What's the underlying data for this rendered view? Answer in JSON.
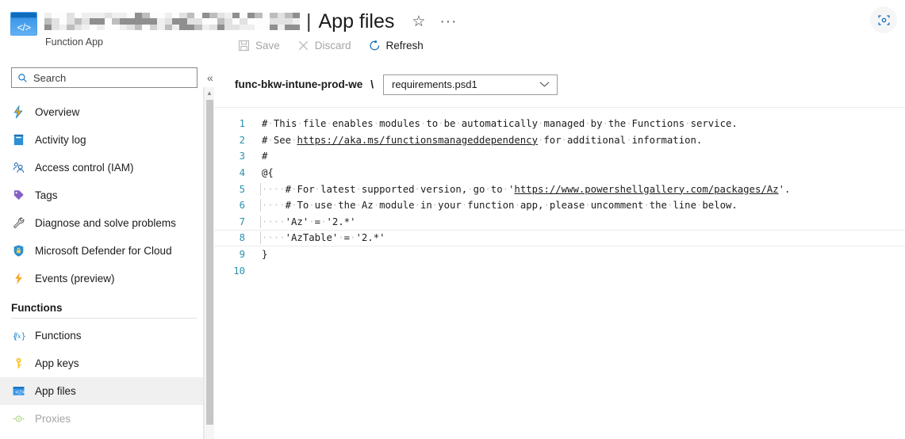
{
  "header": {
    "app_icon_glyph": "</>",
    "resource_name_redacted": true,
    "title_separator": "|",
    "page_title": "App files",
    "subtitle": "Function App",
    "star_icon": "star-outline-icon",
    "ellipsis": "···",
    "feedback_icon": "screenshot-capture-icon"
  },
  "toolbar": {
    "items": [
      {
        "label": "Save",
        "icon": "save-disk-icon",
        "enabled": false
      },
      {
        "label": "Discard",
        "icon": "close-x-icon",
        "enabled": false
      },
      {
        "label": "Refresh",
        "icon": "refresh-circular-arrow-icon",
        "enabled": true
      }
    ]
  },
  "sidebar": {
    "search": {
      "placeholder": "Search",
      "value": "",
      "icon": "search-icon"
    },
    "collapse_icon": "«",
    "items": [
      {
        "label": "Overview",
        "icon": "overview-lightning-icon",
        "selected": false,
        "disabled": false
      },
      {
        "label": "Activity log",
        "icon": "activity-log-book-icon",
        "selected": false,
        "disabled": false
      },
      {
        "label": "Access control (IAM)",
        "icon": "access-control-people-icon",
        "selected": false,
        "disabled": false
      },
      {
        "label": "Tags",
        "icon": "tag-icon",
        "selected": false,
        "disabled": false
      },
      {
        "label": "Diagnose and solve problems",
        "icon": "wrench-icon",
        "selected": false,
        "disabled": false
      },
      {
        "label": "Microsoft Defender for Cloud",
        "icon": "shield-lock-icon",
        "selected": false,
        "disabled": false
      },
      {
        "label": "Events (preview)",
        "icon": "events-lightning-icon",
        "selected": false,
        "disabled": false
      }
    ],
    "group": {
      "title": "Functions",
      "items": [
        {
          "label": "Functions",
          "icon": "function-fx-icon",
          "selected": false,
          "disabled": false
        },
        {
          "label": "App keys",
          "icon": "key-icon",
          "selected": false,
          "disabled": false
        },
        {
          "label": "App files",
          "icon": "app-files-code-window-icon",
          "selected": true,
          "disabled": false
        },
        {
          "label": "Proxies",
          "icon": "proxies-icon",
          "selected": false,
          "disabled": true
        }
      ]
    }
  },
  "content": {
    "breadcrumb_path": "func-bkw-intune-prod-we",
    "breadcrumb_separator": "\\",
    "file_select": {
      "value": "requirements.psd1",
      "chevron": "chevron-down-icon"
    }
  },
  "editor": {
    "line_numbers": [
      "1",
      "2",
      "3",
      "4",
      "5",
      "6",
      "7",
      "8",
      "9",
      "10"
    ],
    "active_line": 8,
    "lines": [
      {
        "n": "1",
        "indent": 0,
        "text": "# This file enables modules to be automatically managed by the Functions service."
      },
      {
        "n": "2",
        "indent": 0,
        "text": "# See https://aka.ms/functionsmanageddependency for additional information.",
        "link": "https://aka.ms/functionsmanageddependency"
      },
      {
        "n": "3",
        "indent": 0,
        "text": "#"
      },
      {
        "n": "4",
        "indent": 0,
        "text": "@{"
      },
      {
        "n": "5",
        "indent": 4,
        "text": "# For latest supported version, go to 'https://www.powershellgallery.com/packages/Az'.",
        "link": "https://www.powershellgallery.com/packages/Az"
      },
      {
        "n": "6",
        "indent": 4,
        "text": "# To use the Az module in your function app, please uncomment the line below."
      },
      {
        "n": "7",
        "indent": 4,
        "text": "'Az' = '2.*'"
      },
      {
        "n": "8",
        "indent": 4,
        "text": "'AzTable' = '2.*'"
      },
      {
        "n": "9",
        "indent": 0,
        "text": "}"
      },
      {
        "n": "10",
        "indent": 0,
        "text": ""
      }
    ]
  }
}
